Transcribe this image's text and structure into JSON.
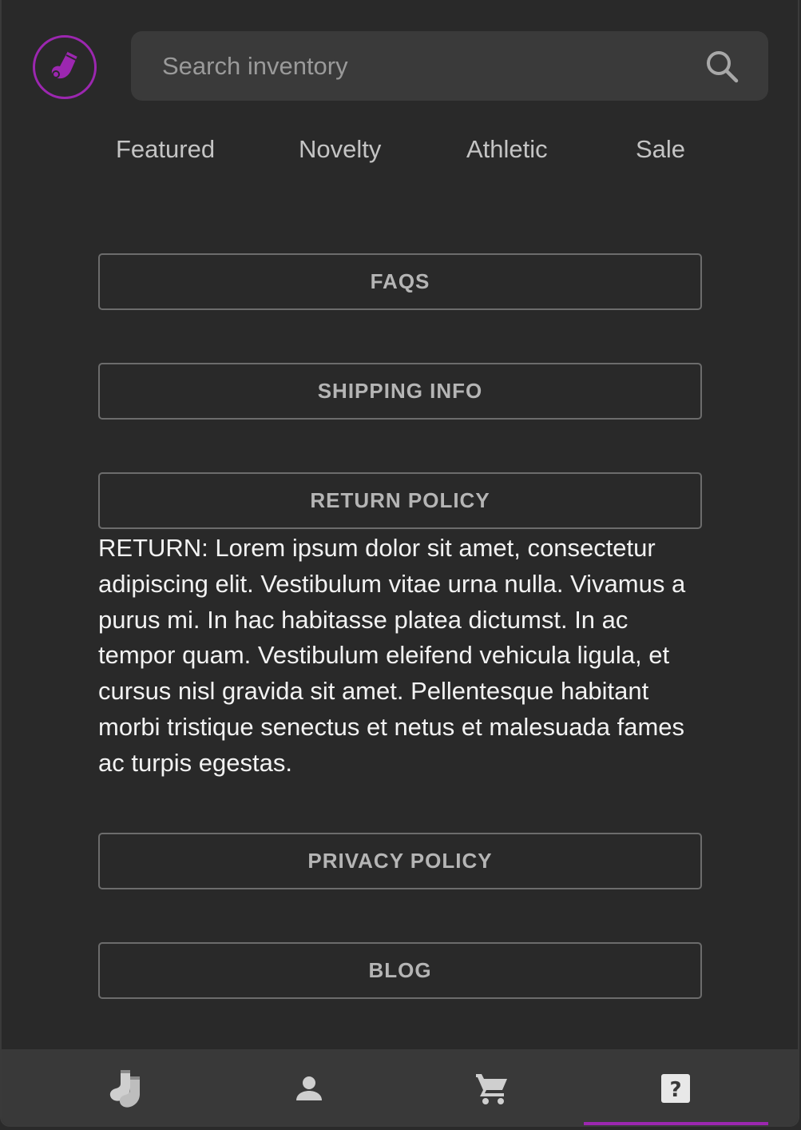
{
  "search": {
    "placeholder": "Search inventory"
  },
  "categories": [
    {
      "label": "Featured"
    },
    {
      "label": "Novelty"
    },
    {
      "label": "Athletic"
    },
    {
      "label": "Sale"
    }
  ],
  "info_sections": {
    "faqs": "FAQS",
    "shipping": "SHIPPING INFO",
    "return": "RETURN POLICY",
    "return_text": "RETURN: Lorem ipsum dolor sit amet, consectetur adipiscing elit. Vestibulum vitae urna nulla. Vivamus a purus mi. In hac habitasse platea dictumst. In ac tempor quam. Vestibulum eleifend vehicula ligula, et cursus nisl gravida sit amet. Pellentesque habitant morbi tristique senectus et netus et malesuada fames ac turpis egestas.",
    "privacy": "PRIVACY POLICY",
    "blog": "BLOG"
  },
  "tabs": [
    {
      "icon": "socks-icon",
      "active": false
    },
    {
      "icon": "person-icon",
      "active": false
    },
    {
      "icon": "cart-icon",
      "active": false
    },
    {
      "icon": "help-icon",
      "active": true
    }
  ],
  "colors": {
    "accent": "#9c27b0",
    "background": "#292929",
    "tabbar": "#393939"
  }
}
